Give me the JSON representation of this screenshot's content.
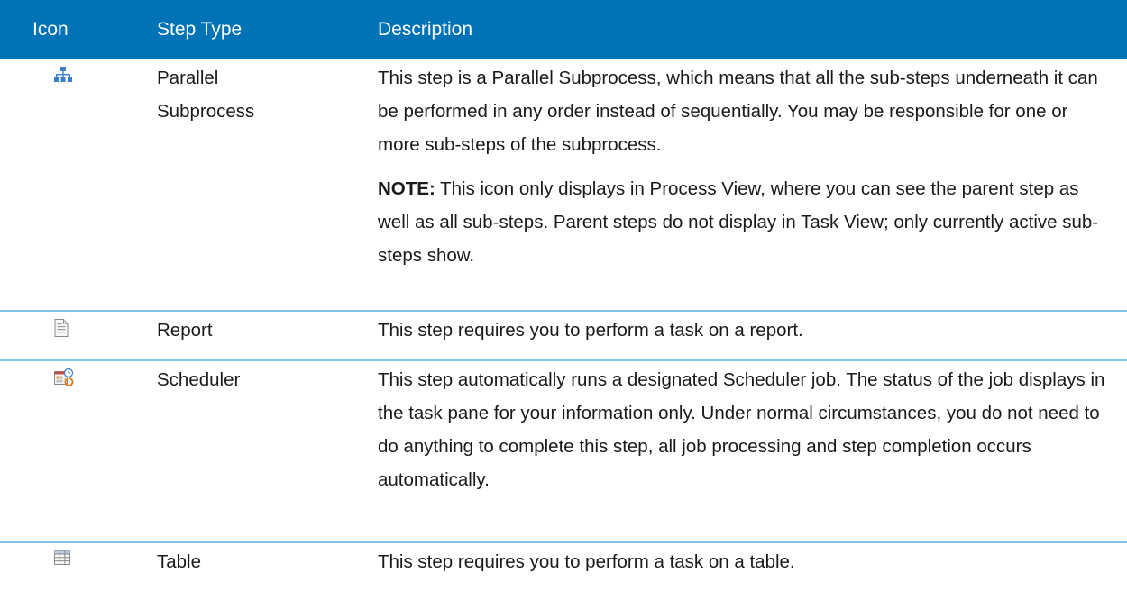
{
  "header": {
    "icon_label": "Icon",
    "type_label": "Step Type",
    "desc_label": "Description"
  },
  "rows": [
    {
      "icon": "parallel-subprocess-icon",
      "type": "Parallel Subprocess",
      "description": "This step is a Parallel Subprocess, which means that all the sub-steps underneath it can be performed in any order instead of sequentially. You may be responsible for one or more sub-steps of the subprocess.",
      "note_label": "NOTE:",
      "note_text": " This icon only displays in Process View, where you can see the parent step as well as all sub-steps. Parent steps do not display in Task View; only currently active sub-steps show."
    },
    {
      "icon": "report-icon",
      "type": "Report",
      "description": "This step requires you to perform a task on a report."
    },
    {
      "icon": "scheduler-icon",
      "type": "Scheduler",
      "description": "This step automatically runs a designated Scheduler job. The status of the job displays in the task pane for your information only. Under normal circumstances, you do not need to do anything to complete this step, all job processing and step completion occurs automatically."
    },
    {
      "icon": "table-icon",
      "type": "Table",
      "description": "This step requires you to perform a task on a table."
    }
  ],
  "colors": {
    "header_bg": "#0073b6",
    "row_divider": "#7fc4e0"
  }
}
